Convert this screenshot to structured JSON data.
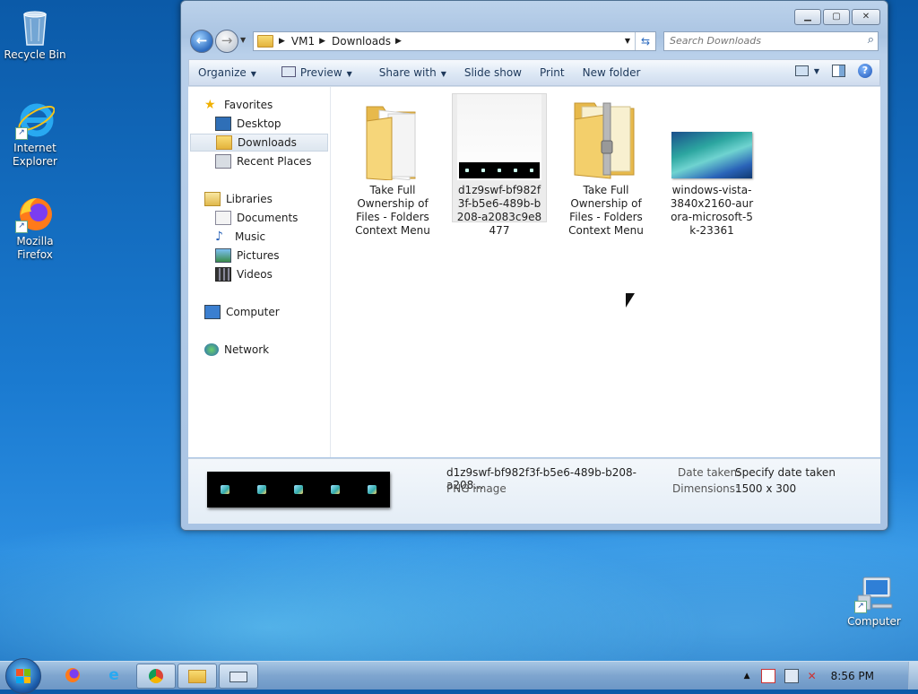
{
  "desktop": {
    "icons": [
      {
        "label": "Recycle Bin"
      },
      {
        "label": "Internet Explorer"
      },
      {
        "label": "Mozilla Firefox"
      },
      {
        "label": "Computer"
      }
    ]
  },
  "window": {
    "address": {
      "segments": [
        "VM1",
        "Downloads"
      ]
    },
    "search": {
      "placeholder": "Search Downloads"
    },
    "toolbar": {
      "organize": "Organize",
      "preview": "Preview",
      "share_with": "Share with",
      "slide_show": "Slide show",
      "print": "Print",
      "new_folder": "New folder"
    },
    "nav": {
      "favorites": "Favorites",
      "desktop": "Desktop",
      "downloads": "Downloads",
      "recent_places": "Recent Places",
      "libraries": "Libraries",
      "documents": "Documents",
      "music": "Music",
      "pictures": "Pictures",
      "videos": "Videos",
      "computer": "Computer",
      "network": "Network"
    },
    "files": [
      {
        "name": "Take Full Ownership of Files - Folders Context Menu",
        "type": "folder"
      },
      {
        "name": "d1z9swf-bf982f3f-b5e6-489b-b208-a2083c9e8477",
        "type": "png",
        "selected": true
      },
      {
        "name": "Take Full Ownership of Files - Folders Context Menu",
        "type": "zip"
      },
      {
        "name": "windows-vista-3840x2160-aurora-microsoft-5k-23361",
        "type": "image"
      }
    ],
    "details": {
      "filename": "d1z9swf-bf982f3f-b5e6-489b-b208-a208...",
      "filetype": "PNG image",
      "date_taken_label": "Date taken:",
      "date_taken_value": "Specify date taken",
      "dimensions_label": "Dimensions:",
      "dimensions_value": "1500 x 300"
    }
  },
  "taskbar": {
    "clock": "8:56 PM"
  }
}
